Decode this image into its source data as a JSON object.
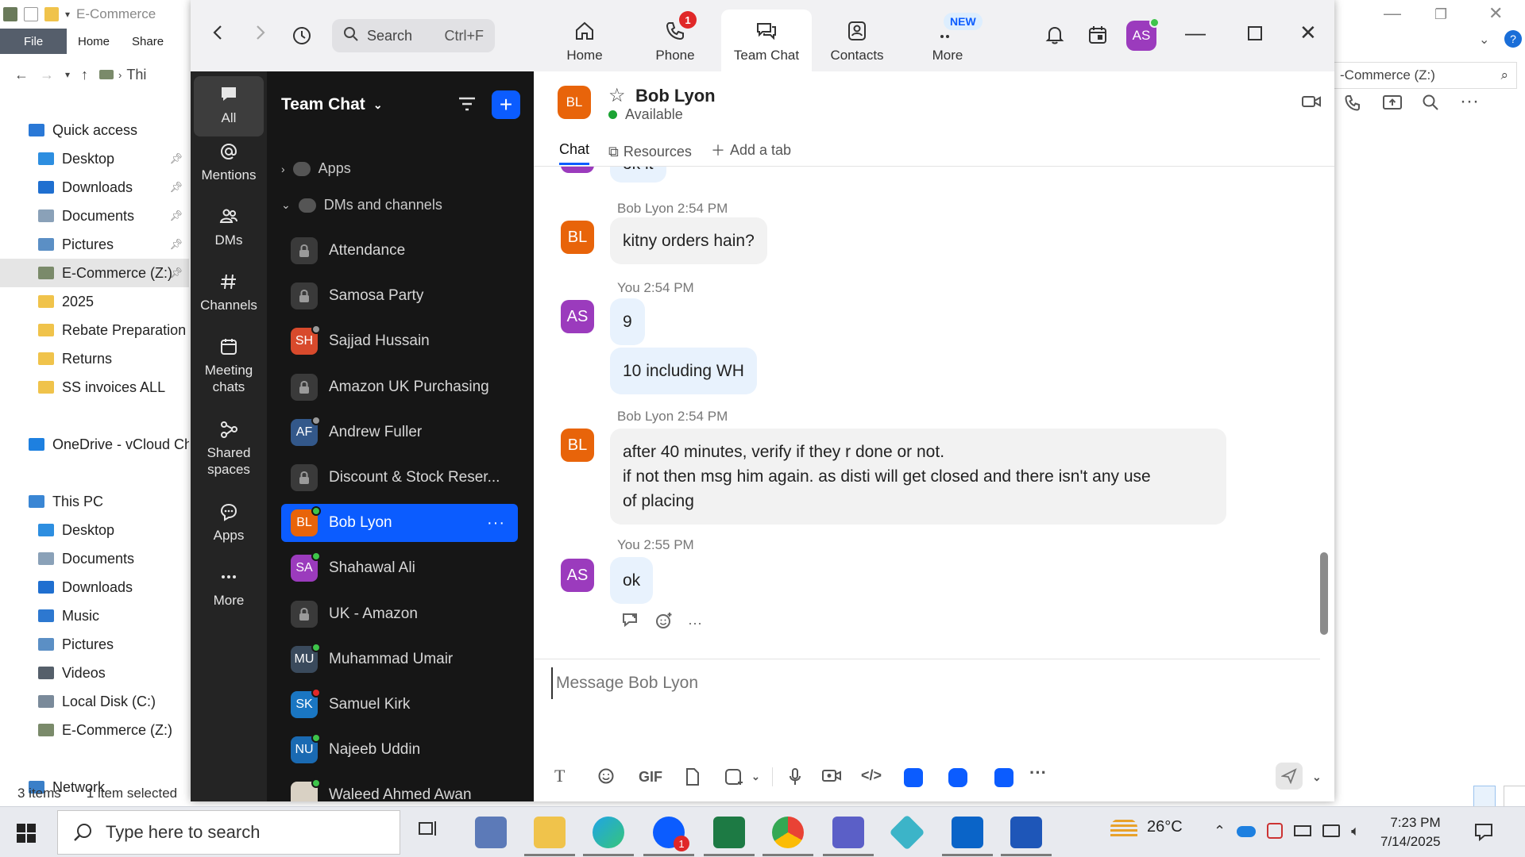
{
  "explorer": {
    "title": "E-Commerce",
    "ribbon": {
      "file": "File",
      "home": "Home",
      "share": "Share"
    },
    "address_crumb": "Thi",
    "right_address": "-Commerce (Z:)",
    "tree": [
      {
        "label": "Quick access",
        "level": 0,
        "color": "#2a78d6",
        "pinned": false,
        "selected": false
      },
      {
        "label": "Desktop",
        "level": 1,
        "color": "#2d8ee0",
        "pinned": true,
        "selected": false
      },
      {
        "label": "Downloads",
        "level": 1,
        "color": "#1f6fd0",
        "pinned": true,
        "selected": false
      },
      {
        "label": "Documents",
        "level": 1,
        "color": "#8aa1b8",
        "pinned": true,
        "selected": false
      },
      {
        "label": "Pictures",
        "level": 1,
        "color": "#5b8fc5",
        "pinned": true,
        "selected": false
      },
      {
        "label": "E-Commerce (Z:)",
        "level": 1,
        "color": "#7a8a6a",
        "pinned": true,
        "selected": true
      },
      {
        "label": "2025",
        "level": 1,
        "color": "#f0c34b",
        "pinned": false,
        "selected": false
      },
      {
        "label": "Rebate Preparation",
        "level": 1,
        "color": "#f0c34b",
        "pinned": false,
        "selected": false
      },
      {
        "label": "Returns",
        "level": 1,
        "color": "#f0c34b",
        "pinned": false,
        "selected": false
      },
      {
        "label": "SS invoices ALL",
        "level": 1,
        "color": "#f0c34b",
        "pinned": false,
        "selected": false
      },
      {
        "label": "",
        "level": 1,
        "color": "transparent",
        "pinned": false,
        "selected": false
      },
      {
        "label": "OneDrive - vCloud Ch",
        "level": 0,
        "color": "#1e80e0",
        "pinned": false,
        "selected": false
      },
      {
        "label": "",
        "level": 1,
        "color": "transparent",
        "pinned": false,
        "selected": false
      },
      {
        "label": "This PC",
        "level": 0,
        "color": "#3a86d4",
        "pinned": false,
        "selected": false
      },
      {
        "label": "Desktop",
        "level": 1,
        "color": "#2d8ee0",
        "pinned": false,
        "selected": false
      },
      {
        "label": "Documents",
        "level": 1,
        "color": "#8aa1b8",
        "pinned": false,
        "selected": false
      },
      {
        "label": "Downloads",
        "level": 1,
        "color": "#1f6fd0",
        "pinned": false,
        "selected": false
      },
      {
        "label": "Music",
        "level": 1,
        "color": "#2d78d0",
        "pinned": false,
        "selected": false
      },
      {
        "label": "Pictures",
        "level": 1,
        "color": "#5b8fc5",
        "pinned": false,
        "selected": false
      },
      {
        "label": "Videos",
        "level": 1,
        "color": "#555f6a",
        "pinned": false,
        "selected": false
      },
      {
        "label": "Local Disk (C:)",
        "level": 1,
        "color": "#7a8a9a",
        "pinned": false,
        "selected": false
      },
      {
        "label": "E-Commerce (Z:)",
        "level": 1,
        "color": "#7a8a6a",
        "pinned": false,
        "selected": false
      },
      {
        "label": "",
        "level": 1,
        "color": "transparent",
        "pinned": false,
        "selected": false
      },
      {
        "label": "Network",
        "level": 0,
        "color": "#3a7fc8",
        "pinned": false,
        "selected": false
      }
    ],
    "status": {
      "items": "3 items",
      "selected": "1 item selected"
    }
  },
  "zoom": {
    "search": {
      "placeholder": "Search",
      "shortcut": "Ctrl+F"
    },
    "tabs": {
      "home": "Home",
      "phone": "Phone",
      "phone_badge": "1",
      "team_chat": "Team Chat",
      "contacts": "Contacts",
      "more": "More",
      "more_badge": "NEW"
    },
    "user_initials": "AS",
    "rail": {
      "all": "All",
      "mentions": "Mentions",
      "dms": "DMs",
      "channels": "Channels",
      "meeting_chats": "Meeting chats",
      "shared_spaces": "Shared spaces",
      "apps": "Apps",
      "more": "More"
    },
    "chat_list": {
      "title": "Team Chat",
      "apps_section": "Apps",
      "dms_section": "DMs and channels",
      "rows": [
        {
          "name": "Attendance",
          "initials": "",
          "color": "lock",
          "status": ""
        },
        {
          "name": "Samosa Party",
          "initials": "",
          "color": "lock",
          "status": ""
        },
        {
          "name": "Sajjad Hussain",
          "initials": "SH",
          "color": "#d84a2c",
          "status": "#9a9a9a"
        },
        {
          "name": "Amazon UK Purchasing",
          "initials": "",
          "color": "lock",
          "status": ""
        },
        {
          "name": "Andrew Fuller",
          "initials": "AF",
          "color": "#33588a",
          "status": "#9a9a9a"
        },
        {
          "name": "Discount & Stock Reser...",
          "initials": "",
          "color": "lock",
          "status": ""
        },
        {
          "name": "Bob Lyon",
          "initials": "BL",
          "color": "#e8640a",
          "status": "#3ec44a"
        },
        {
          "name": "Shahawal Ali",
          "initials": "SA",
          "color": "#9b3bbd",
          "status": "#3ec44a"
        },
        {
          "name": "UK - Amazon",
          "initials": "",
          "color": "lock",
          "status": ""
        },
        {
          "name": "Muhammad Umair",
          "initials": "MU",
          "color": "#3a4a5c",
          "status": "#3ec44a"
        },
        {
          "name": "Samuel Kirk",
          "initials": "SK",
          "color": "#1a76c2",
          "status": "#e02828"
        },
        {
          "name": "Najeeb Uddin",
          "initials": "NU",
          "color": "#1a6ab2",
          "status": "#3ec44a"
        },
        {
          "name": "Waleed Ahmed Awan",
          "initials": "",
          "color": "#d9d1c4",
          "status": "#3ec44a"
        }
      ]
    },
    "header": {
      "initials": "BL",
      "name": "Bob Lyon",
      "status": "Available",
      "tab_chat": "Chat",
      "tab_resources": "Resources",
      "tab_add": "Add a tab"
    },
    "messages": {
      "partial": "ok it",
      "m1_meta": "Bob Lyon 2:54 PM",
      "m1_initials": "BL",
      "m1_text": "kitny orders hain?",
      "m2_meta": "You 2:54 PM",
      "m2_initials": "AS",
      "m2_text_a": "9",
      "m2_text_b": "10 including WH",
      "m3_meta": "Bob Lyon 2:54 PM",
      "m3_initials": "BL",
      "m3_line1": "after 40 minutes, verify if they r done or not.",
      "m3_line2": "if not then msg him again. as disti will get closed and there isn't any use",
      "m3_line3": "of placing",
      "m4_meta": "You 2:55 PM",
      "m4_initials": "AS",
      "m4_text": "ok"
    },
    "composer": {
      "placeholder": "Message Bob Lyon",
      "gif": "GIF"
    }
  },
  "taskbar": {
    "search_placeholder": "Type here to search",
    "zoom_badge": "1",
    "temperature": "26°C",
    "time": "7:23 PM",
    "date": "7/14/2025"
  },
  "colors": {
    "accent": "#0b5cff",
    "rail_bg": "#242424",
    "list_bg": "#161616"
  }
}
